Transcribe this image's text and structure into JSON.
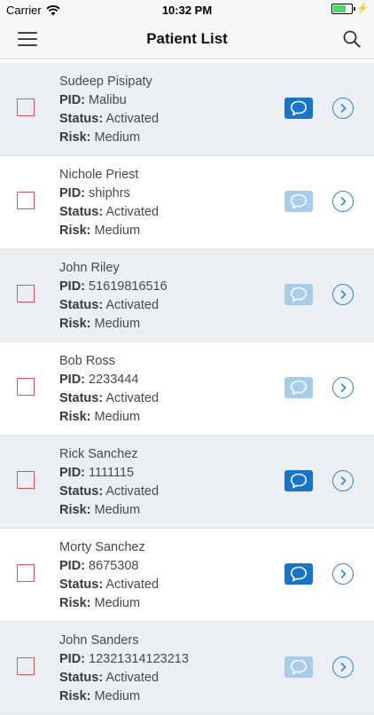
{
  "status_bar": {
    "carrier": "Carrier",
    "time": "10:32 PM"
  },
  "nav": {
    "title": "Patient List",
    "menu_icon": "menu-icon",
    "search_icon": "search-icon"
  },
  "labels": {
    "pid": "PID:",
    "status": "Status:",
    "risk": "Risk:"
  },
  "patients": [
    {
      "name": "Sudeep Pisipaty",
      "pid": "Malibu",
      "status": "Activated",
      "risk": "Medium",
      "chat_active": true
    },
    {
      "name": "Nichole Priest",
      "pid": "shiphrs",
      "status": "Activated",
      "risk": "Medium",
      "chat_active": false
    },
    {
      "name": "John Riley",
      "pid": "51619816516",
      "status": "Activated",
      "risk": "Medium",
      "chat_active": false
    },
    {
      "name": "Bob Ross",
      "pid": "2233444",
      "status": "Activated",
      "risk": "Medium",
      "chat_active": false
    },
    {
      "name": "Rick Sanchez",
      "pid": "1111115",
      "status": "Activated",
      "risk": "Medium",
      "chat_active": true
    },
    {
      "name": "Morty Sanchez",
      "pid": "8675308",
      "status": "Activated",
      "risk": "Medium",
      "chat_active": true
    },
    {
      "name": "John Sanders",
      "pid": "12321314123213",
      "status": "Activated",
      "risk": "Medium",
      "chat_active": false
    }
  ],
  "colors": {
    "row_alt": "#ebeef3",
    "checkbox_border": "#e5545c",
    "chat_active": "#1774c7",
    "chat_inactive": "#a8cdea",
    "chevron": "#2f86d4"
  }
}
